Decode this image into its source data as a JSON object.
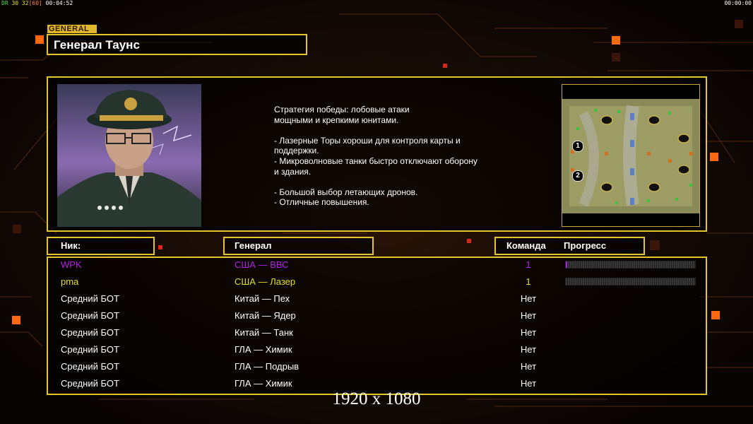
{
  "hud": {
    "top_left_label": "DR",
    "top_left_fps": "30 32",
    "top_left_bracket": "[60]",
    "top_left_time": "00:04:52",
    "top_right_time": "00:00:00"
  },
  "general": {
    "tag": "GENERAL",
    "name": "Генерал Таунс",
    "description": "Стратегия победы: лобовые атаки\nмощными и крепкими юнитами.\n\n- Лазерные Торы хороши для контроля карты и\n поддержки.\n- Микроволновые танки быстро отключают оборону\n и здания.\n\n- Большой выбор летающих дронов.\n- Отличные повышения."
  },
  "minimap": {
    "start_positions": [
      "1",
      "2"
    ]
  },
  "columns": {
    "nick": "Ник:",
    "general": "Генерал",
    "team": "Команда",
    "progress": "Прогресс"
  },
  "players": [
    {
      "nick": "WPK",
      "general": "США — ВВС",
      "team": "1",
      "color": "#b020e8",
      "progress": 0.01
    },
    {
      "nick": "pma",
      "general": "США — Лазер",
      "team": "1",
      "color": "#e0e030",
      "progress": 0.0
    },
    {
      "nick": "Средний БОТ",
      "general": "Китай — Пех",
      "team": "Нет",
      "color": "#ffffff"
    },
    {
      "nick": "Средний БОТ",
      "general": "Китай — Ядер",
      "team": "Нет",
      "color": "#ffffff"
    },
    {
      "nick": "Средний БОТ",
      "general": "Китай — Танк",
      "team": "Нет",
      "color": "#ffffff"
    },
    {
      "nick": "Средний БОТ",
      "general": "ГЛА — Химик",
      "team": "Нет",
      "color": "#ffffff"
    },
    {
      "nick": "Средний БОТ",
      "general": "ГЛА — Подрыв",
      "team": "Нет",
      "color": "#ffffff"
    },
    {
      "nick": "Средний БОТ",
      "general": "ГЛА — Химик",
      "team": "Нет",
      "color": "#ffffff"
    }
  ],
  "overlay": {
    "resolution": "1920 x 1080"
  },
  "colors": {
    "frame": "#e3c72a",
    "accent_orange": "#ff6a10"
  }
}
